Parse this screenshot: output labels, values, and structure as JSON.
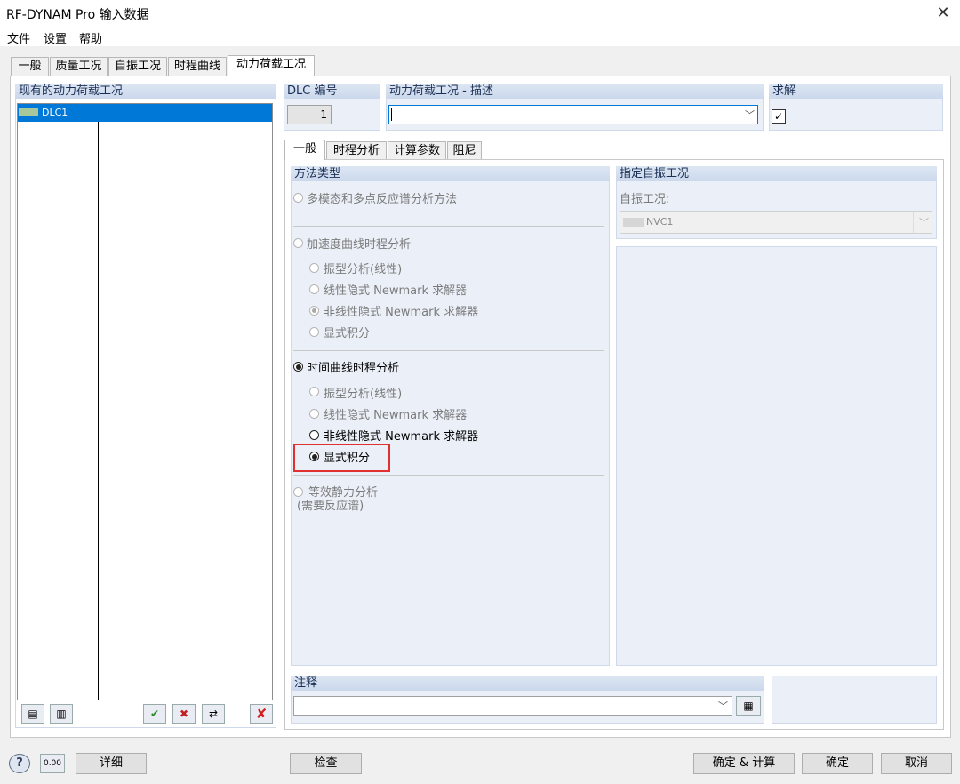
{
  "window": {
    "title": "RF-DYNAM Pro 输入数据",
    "close_glyph": "✕"
  },
  "menu": [
    "文件",
    "设置",
    "帮助"
  ],
  "main_tabs": [
    "一般",
    "质量工况",
    "自振工况",
    "时程曲线",
    "动力荷载工况"
  ],
  "left_panel": {
    "title": "现有的动力荷载工况",
    "items": [
      {
        "label": "DLC1",
        "selected": true
      }
    ]
  },
  "dlc": {
    "title": "DLC 编号",
    "value": "1"
  },
  "description": {
    "title": "动力荷载工况 - 描述",
    "value": ""
  },
  "solve": {
    "title": "求解",
    "checked": true,
    "check_glyph": "✓"
  },
  "sub_tabs": [
    "一般",
    "时程分析",
    "计算参数",
    "阻尼"
  ],
  "method": {
    "title": "方法类型",
    "multimodal": "多模态和多点反应谱分析方法",
    "accel": {
      "label": "加速度曲线时程分析",
      "options": [
        "振型分析(线性)",
        "线性隐式 Newmark 求解器",
        "非线性隐式 Newmark 求解器",
        "显式积分"
      ]
    },
    "time": {
      "label": "时间曲线时程分析",
      "selected": true,
      "options": [
        "振型分析(线性)",
        "线性隐式 Newmark 求解器",
        "非线性隐式 Newmark 求解器",
        "显式积分"
      ],
      "selected_option": "显式积分"
    },
    "static": {
      "line1": "等效静力分析",
      "line2": "(需要反应谱)"
    }
  },
  "natural": {
    "title": "指定自振工况",
    "label": "自振工况:",
    "value": "NVC1"
  },
  "comment": {
    "title": "注释",
    "value": ""
  },
  "footer": {
    "details": "详细",
    "check": "检查",
    "ok_calc": "确定 & 计算",
    "ok": "确定",
    "cancel": "取消"
  },
  "colors": {
    "selection": "#0078d7",
    "group_bg": "#ebf0f8",
    "highlight_box": "#e03030"
  }
}
